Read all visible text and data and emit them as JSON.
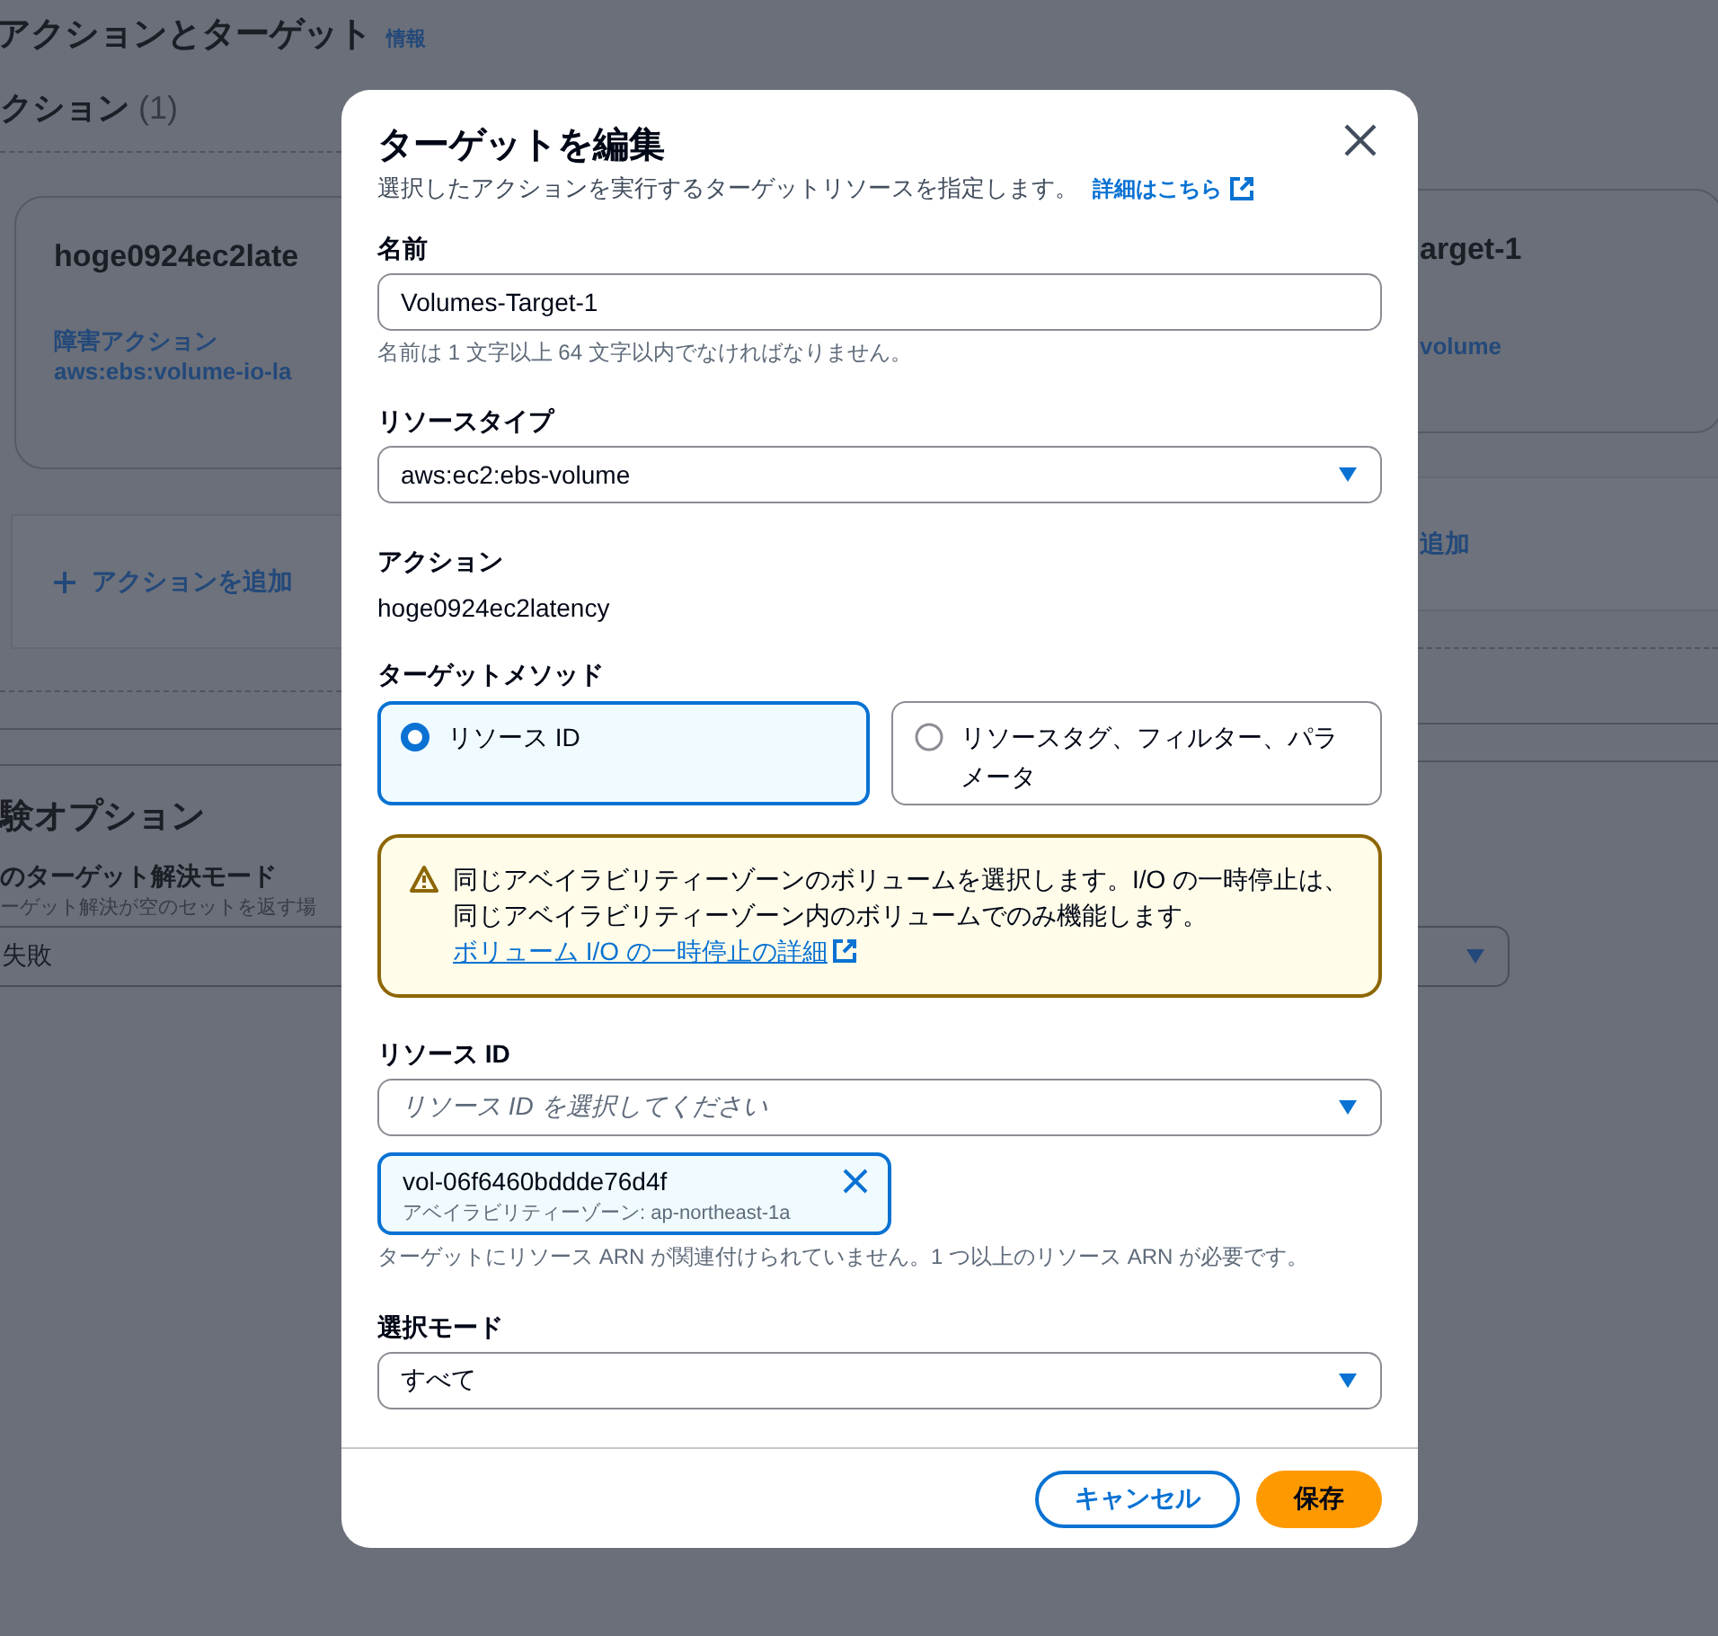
{
  "background": {
    "section_title": "アクションとターゲット",
    "info_link": "情報",
    "actions_heading": "クション",
    "actions_count": "(1)",
    "action_card": {
      "name": "hoge0924ec2late",
      "fault_label": "障害アクション",
      "fault_value": "aws:ebs:volume-io-la"
    },
    "add_action": "アクションを追加",
    "target_card": {
      "name": "arget-1",
      "resource_type": "volume"
    },
    "add_target": "追加",
    "options_heading": "験オプション",
    "resolution_label": "のターゲット解決モード",
    "resolution_desc": "ーゲット解決が空のセットを返す場",
    "resolution_value": "失敗"
  },
  "dialog": {
    "title": "ターゲットを編集",
    "description": "選択したアクションを実行するターゲットリソースを指定します。",
    "learn_more": "詳細はこちら",
    "name": {
      "label": "名前",
      "value": "Volumes-Target-1",
      "hint": "名前は 1 文字以上 64 文字以内でなければなりません。"
    },
    "resource_type": {
      "label": "リソースタイプ",
      "value": "aws:ec2:ebs-volume"
    },
    "action": {
      "label": "アクション",
      "value": "hoge0924ec2latency"
    },
    "target_method": {
      "label": "ターゲットメソッド",
      "options": [
        {
          "label": "リソース ID",
          "selected": true
        },
        {
          "label": "リソースタグ、フィルター、パラメータ",
          "selected": false
        }
      ]
    },
    "alert": {
      "text": "同じアベイラビリティーゾーンのボリュームを選択します。I/O の一時停止は、同じアベイラビリティーゾーン内のボリュームでのみ機能します。",
      "link": "ボリューム I/O の一時停止の詳細"
    },
    "resource_id": {
      "label": "リソース ID",
      "placeholder": "リソース ID を選択してください",
      "tokens": [
        {
          "id": "vol-06f6460bddde76d4f",
          "detail": "アベイラビリティーゾーン: ap-northeast-1a"
        }
      ],
      "hint": "ターゲットにリソース ARN が関連付けられていません。1 つ以上のリソース ARN が必要です。"
    },
    "selection_mode": {
      "label": "選択モード",
      "value": "すべて"
    },
    "buttons": [
      {
        "label": "キャンセル",
        "kind": "secondary"
      },
      {
        "label": "保存",
        "kind": "primary"
      }
    ]
  }
}
